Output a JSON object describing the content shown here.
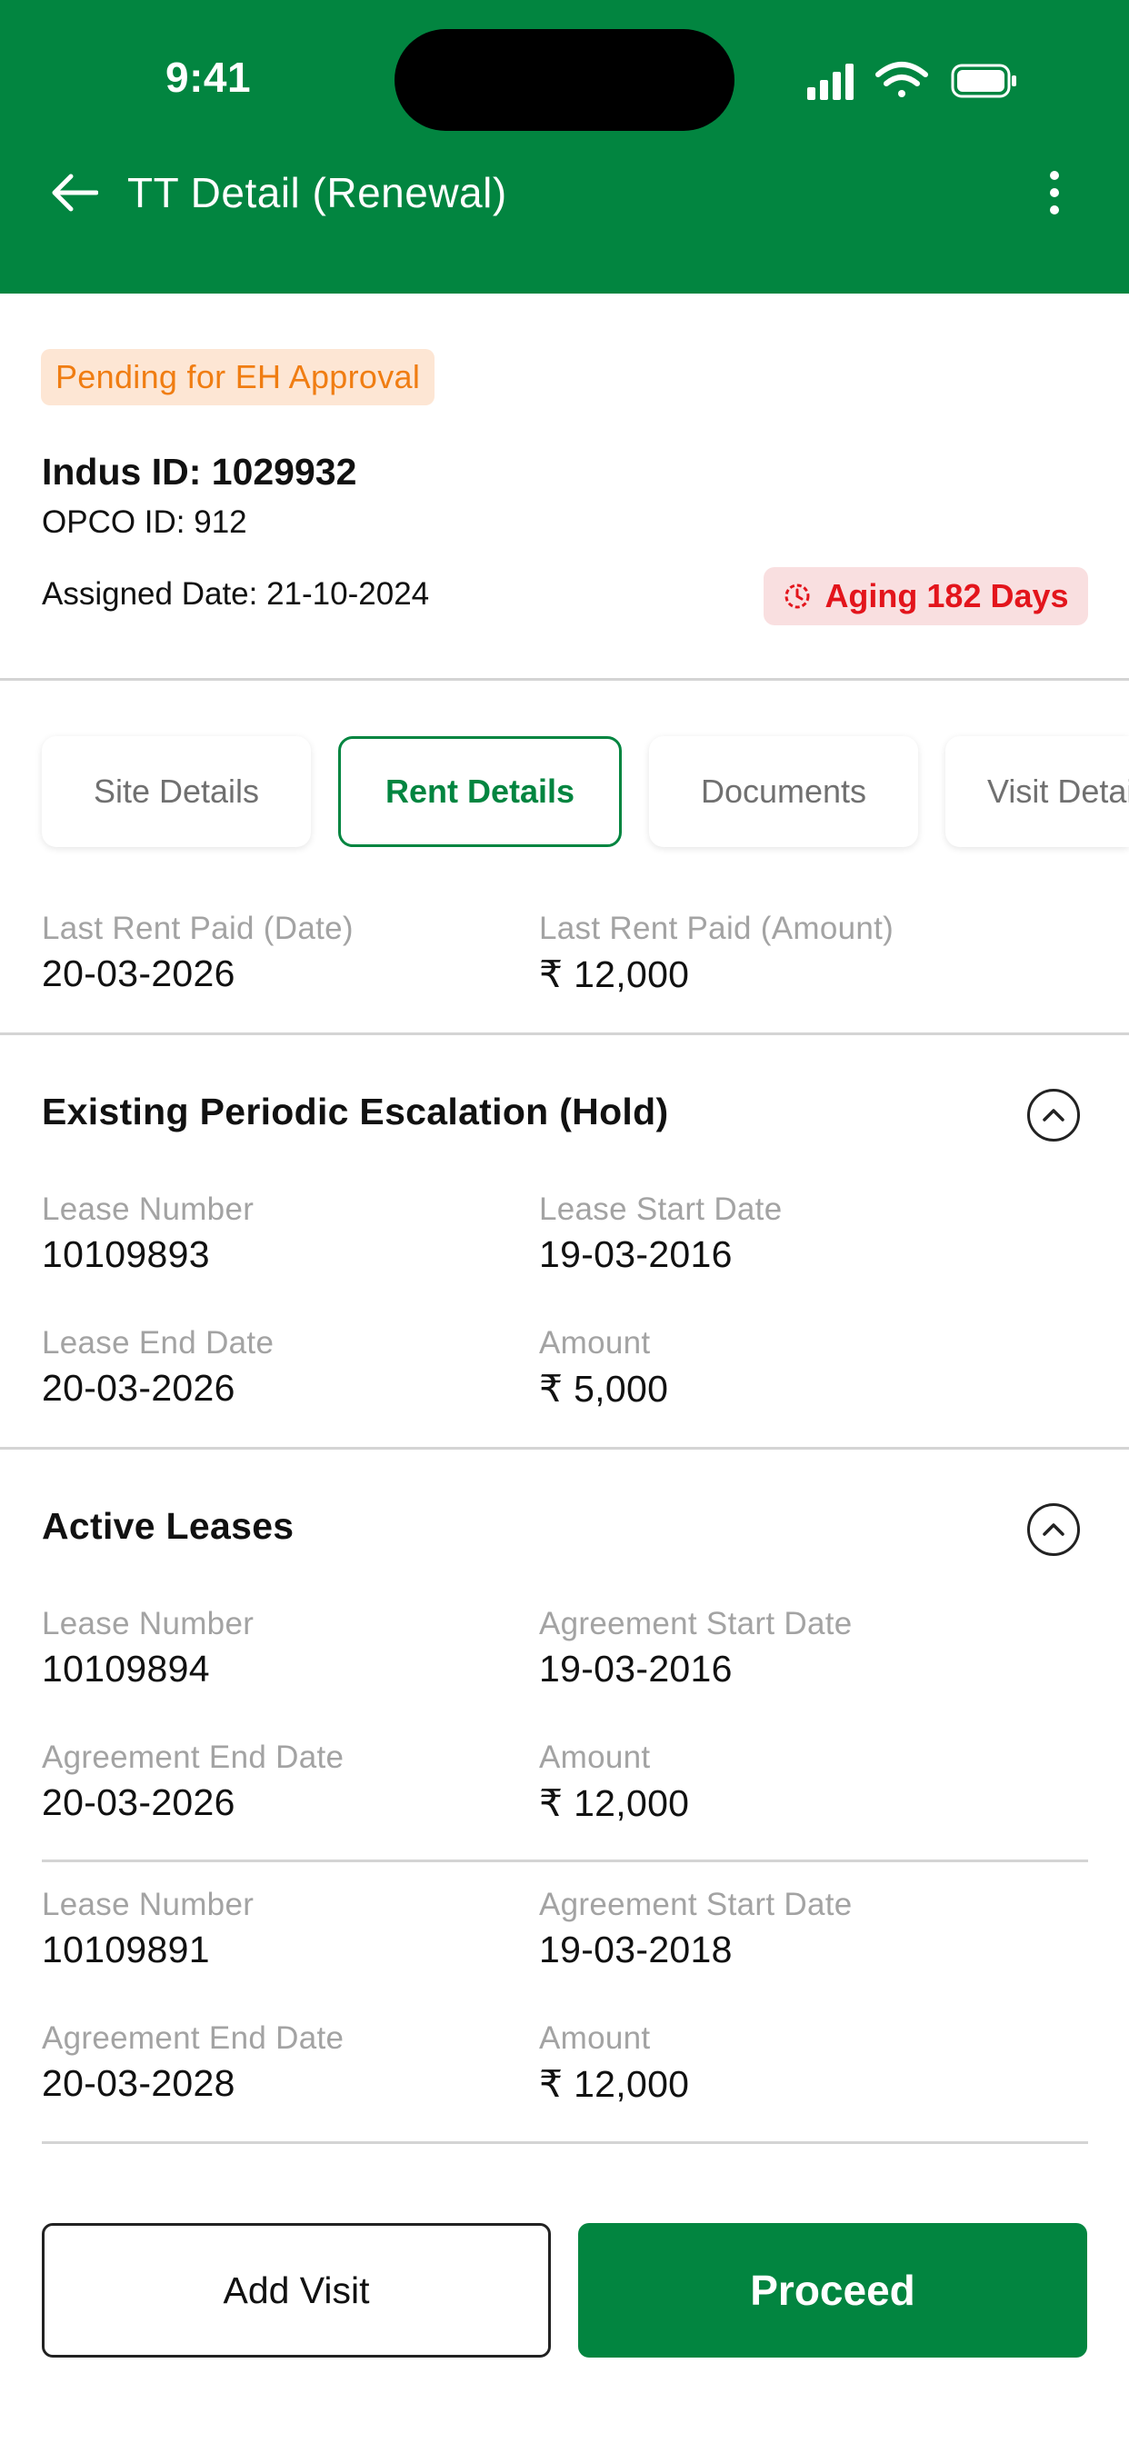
{
  "status_bar": {
    "time": "9:41"
  },
  "header": {
    "title": "TT Detail (Renewal)"
  },
  "summary": {
    "status_chip": "Pending for EH Approval",
    "indus_id": "Indus ID: 1029932",
    "opco_id": "OPCO ID: 912",
    "assigned_date": "Assigned Date: 21-10-2024",
    "aging": "Aging 182 Days"
  },
  "tabs": [
    {
      "label": "Site Details"
    },
    {
      "label": "Rent Details",
      "active": true
    },
    {
      "label": "Documents"
    },
    {
      "label": "Visit Details"
    }
  ],
  "last_rent": {
    "date_label": "Last Rent Paid (Date)",
    "date_value": "20-03-2026",
    "amount_label": "Last Rent Paid (Amount)",
    "amount_value": "₹ 12,000"
  },
  "escalation": {
    "title": "Existing Periodic Escalation (Hold)",
    "lease_number_label": "Lease Number",
    "lease_number": "10109893",
    "start_label": "Lease Start Date",
    "start": "19-03-2016",
    "end_label": "Lease End Date",
    "end": "20-03-2026",
    "amount_label": "Amount",
    "amount": "₹ 5,000"
  },
  "active_leases": {
    "title": "Active Leases",
    "items": [
      {
        "lease_number_label": "Lease Number",
        "lease_number": "10109894",
        "start_label": "Agreement Start Date",
        "start": "19-03-2016",
        "end_label": "Agreement End Date",
        "end": "20-03-2026",
        "amount_label": "Amount",
        "amount": "₹ 12,000"
      },
      {
        "lease_number_label": "Lease Number",
        "lease_number": "10109891",
        "start_label": "Agreement Start Date",
        "start": "19-03-2018",
        "end_label": "Agreement End Date",
        "end": "20-03-2028",
        "amount_label": "Amount",
        "amount": "₹ 12,000"
      }
    ]
  },
  "actions": {
    "add_visit": "Add Visit",
    "proceed": "Proceed"
  },
  "colors": {
    "brand": "#028540",
    "chip_text": "#f07d12",
    "chip_bg": "#fde6d4",
    "aging_text": "#e3151c",
    "aging_bg": "#f9dfe0"
  }
}
